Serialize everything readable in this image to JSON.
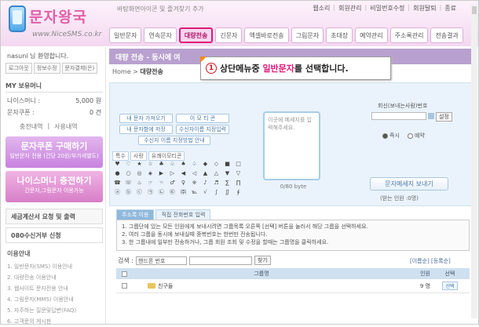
{
  "header": {
    "logo_name": "문자왕국",
    "logo_url": "www.NiceSMS.co.kr",
    "tagline": "바탕화면아이콘 및 즐겨찾기 추가",
    "top_links": [
      "웹소리",
      "회원관리",
      "비밀번호수정",
      "회원탈퇴",
      "종료"
    ]
  },
  "menu": [
    "일반문자",
    "연속문자",
    "대량전송",
    "긴문자",
    "엑셀바로전송",
    "그림문자",
    "초대장",
    "예약관리",
    "주소록관리",
    "전송결과"
  ],
  "menu_active_index": 2,
  "sidebar": {
    "welcome": "nasuni 님 환영합니다.",
    "account_buttons": [
      "로그아웃",
      "정보수정",
      "문자결제(은)"
    ],
    "my_title": "MY 보유머니",
    "money_rows": [
      {
        "label": "나이스머니 :",
        "value": "5,000 원"
      },
      {
        "label": "문자쿠폰 :",
        "value": "0 건"
      }
    ],
    "history_links": [
      "충전내역",
      "사용내역"
    ],
    "promo1_title": "문자쿠폰 구매하기",
    "promo1_sub": "일반문자 전용 (건당 20원/부가세별도)",
    "promo2_title": "나이스머니 충전하기",
    "promo2_sub": "긴문자,그림문자 이용가능",
    "tax_item": "세금계산서 요청 및 출력",
    "reject_item": "080수신거부 신청",
    "guide_title": "이용안내",
    "guide_items": [
      "1. 일반문자(SMS) 이용안내",
      "2. 대량전송 이용안내",
      "3. 웹사이트 문자전용 안내",
      "4. 그림문자(MMS) 이용안내",
      "5. 자주하는 질문및답변(FAQ)",
      "6. 고객문의 게시판"
    ]
  },
  "main": {
    "title": "대량 전송 - 동시에 여",
    "breadcrumb_home": "Home",
    "breadcrumb_current": "대량전송",
    "tooltip_num": "1",
    "tooltip_pre": "상단메뉴중 ",
    "tooltip_hl": "일반문자",
    "tooltip_post": "를 선택합니다.",
    "msg_buttons": [
      "내 문자 가져오기",
      "이 모 티 콘",
      "내 문자함에 저장",
      "수신자이름 지정입력",
      "수신자 이름 지정방법 안내"
    ],
    "char_tabs": [
      "특수",
      "사랑",
      "유쾌이모티콘"
    ],
    "chars": [
      "♥",
      "♡",
      "★",
      "☆",
      "♣",
      "♧",
      "♠",
      "♤",
      "◆",
      "◇",
      "■",
      "□",
      "●",
      "○",
      "◎",
      "◈",
      "▶",
      "▷",
      "◀",
      "◁",
      "▲",
      "△",
      "▼",
      "▽",
      "☎",
      "☏",
      "♨",
      "☞",
      "☜",
      "♂",
      "♀",
      "※",
      "♪",
      "♬",
      "∑",
      "∏",
      "ⓐ",
      "ⓑ",
      "ⓒ",
      "㉠",
      "㉡",
      "㉢",
      "㈜",
      "℡",
      "√",
      "∫",
      "∬",
      "∮"
    ],
    "msg_placeholder": "이곳에 메세지를 입력해주세요.",
    "byte_count": "0/80 byte",
    "recv_label": "회신(보내는사람)번호",
    "set_btn": "설정",
    "radio_now": "즉시",
    "radio_reserve": "예약",
    "send_btn": "문자메세지 보내기",
    "send_count": "(받는 인원 :0명)",
    "list_tabs": [
      "주소록 이용",
      "직접 전화번호 입력"
    ],
    "notice": [
      "1. 그룹단에 있는 모든 인원에게 보내시려면 그룹목록 오른쪽 [선택] 버튼을 눌러서 해당 그룹을 선택하세요.",
      "2. 여러 그룹을 동시에 보내실때 중복번호는 한번만 전송됩니다.",
      "3. 한 그룹내에 일부만 전송하거나, 그룹 회원 조회 및 수정을 할때는 그룹명을 클릭하세요."
    ],
    "search_label": "검색 :",
    "search_select": "핸드폰 번호",
    "search_btn": "찾기",
    "sort_links": "[이름순] [등록순]",
    "table_headers": {
      "name": "그룹명",
      "count": "인원",
      "select": "선택"
    },
    "rows": [
      {
        "name": "친구들",
        "count": "9 명",
        "select": "선택"
      }
    ]
  }
}
